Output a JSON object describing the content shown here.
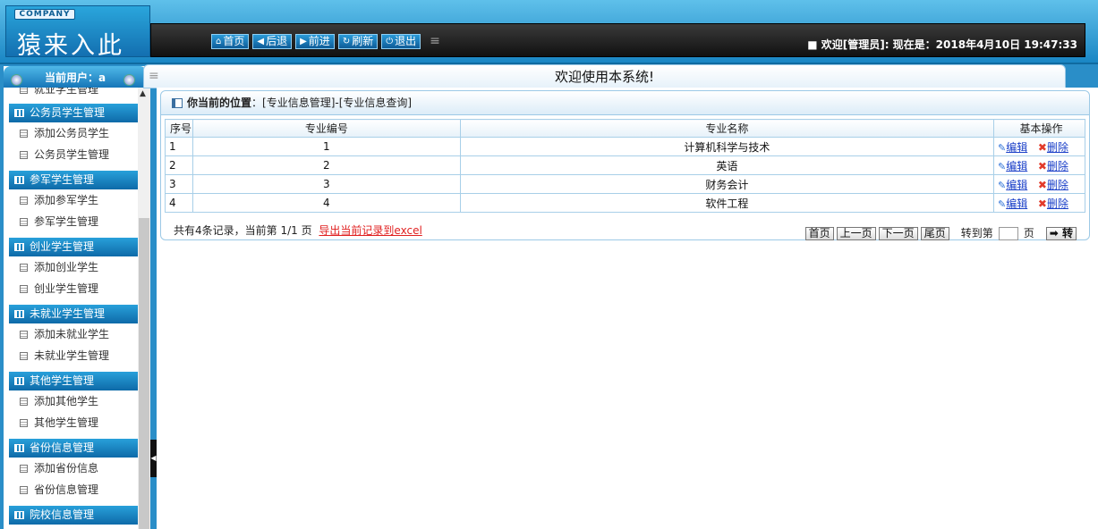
{
  "header": {
    "company_badge": "COMPANY",
    "app_title": "猿来入此",
    "toolbar": [
      {
        "label": "首页",
        "icon": "home-icon"
      },
      {
        "label": "后退",
        "icon": "arrow-left-icon"
      },
      {
        "label": "前进",
        "icon": "arrow-right-icon"
      },
      {
        "label": "刷新",
        "icon": "refresh-icon"
      },
      {
        "label": "退出",
        "icon": "power-icon"
      }
    ],
    "welcome": "■ 欢迎[管理员]: 现在是：2018年4月10日 19:47:33"
  },
  "sidebar": {
    "current_user": "当前用户：a",
    "top_partial_item": "就业学生管理",
    "groups": [
      {
        "title": "公务员学生管理",
        "items": [
          "添加公务员学生",
          "公务员学生管理"
        ]
      },
      {
        "title": "参军学生管理",
        "items": [
          "添加参军学生",
          "参军学生管理"
        ]
      },
      {
        "title": "创业学生管理",
        "items": [
          "添加创业学生",
          "创业学生管理"
        ]
      },
      {
        "title": "未就业学生管理",
        "items": [
          "添加未就业学生",
          "未就业学生管理"
        ]
      },
      {
        "title": "其他学生管理",
        "items": [
          "添加其他学生",
          "其他学生管理"
        ]
      },
      {
        "title": "省份信息管理",
        "items": [
          "添加省份信息",
          "省份信息管理"
        ]
      },
      {
        "title": "院校信息管理",
        "items": []
      }
    ]
  },
  "main": {
    "welcome_banner": "欢迎使用本系统!",
    "breadcrumb_label": "你当前的位置",
    "breadcrumb_path": "：[专业信息管理]-[专业信息查询]",
    "table": {
      "headers": [
        "序号",
        "专业编号",
        "专业名称",
        "基本操作"
      ],
      "rows": [
        {
          "idx": "1",
          "code": "1",
          "name": "计算机科学与技术"
        },
        {
          "idx": "2",
          "code": "2",
          "name": "英语"
        },
        {
          "idx": "3",
          "code": "3",
          "name": "财务会计"
        },
        {
          "idx": "4",
          "code": "4",
          "name": "软件工程"
        }
      ],
      "edit_label": "编辑",
      "delete_label": "删除"
    },
    "pager": {
      "summary": "共有4条记录，当前第 1/1 页",
      "export_label": "导出当前记录到excel",
      "first": "首页",
      "prev": "上一页",
      "next": "下一页",
      "last": "尾页",
      "goto_prefix": "转到第",
      "goto_suffix": "页",
      "go": "转"
    }
  },
  "colors": {
    "accent": "#1a86c4",
    "dark_bar": "#1a1a1a",
    "link": "#1a3fc8",
    "export_link": "#e02020"
  }
}
